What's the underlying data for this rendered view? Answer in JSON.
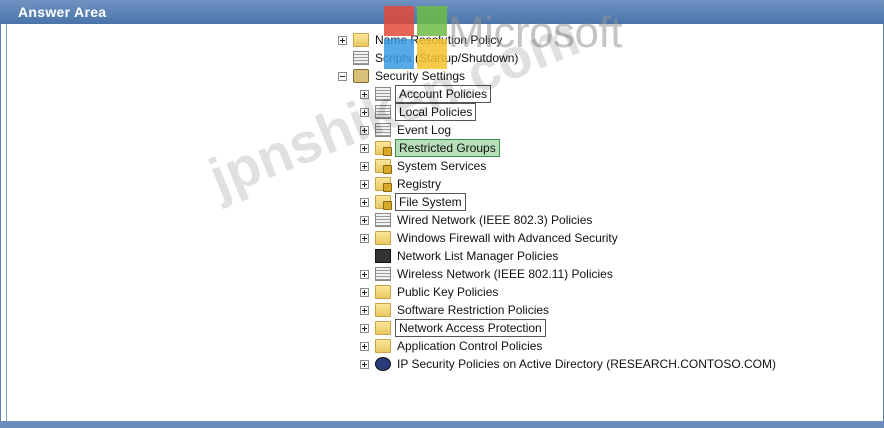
{
  "panel": {
    "title": "Answer Area"
  },
  "tree": {
    "items": [
      {
        "label": "Name Resolution Policy",
        "icon": "folder-icon",
        "expander": "plus"
      },
      {
        "label": "Scripts (Startup/Shutdown)",
        "icon": "script-icon",
        "expander": "none"
      },
      {
        "label": "Security Settings",
        "icon": "security-settings-icon",
        "expander": "minus"
      },
      {
        "label": "Account Policies",
        "icon": "policy-doc-icon",
        "expander": "plus",
        "boxed": true
      },
      {
        "label": "Local Policies",
        "icon": "policy-doc-icon",
        "expander": "plus",
        "boxed": true
      },
      {
        "label": "Event Log",
        "icon": "policy-doc-icon",
        "expander": "plus"
      },
      {
        "label": "Restricted Groups",
        "icon": "locked-folder-icon",
        "expander": "plus",
        "highlight": true
      },
      {
        "label": "System Services",
        "icon": "locked-folder-icon",
        "expander": "plus"
      },
      {
        "label": "Registry",
        "icon": "locked-folder-icon",
        "expander": "plus"
      },
      {
        "label": "File System",
        "icon": "locked-folder-icon",
        "expander": "plus",
        "boxed": true
      },
      {
        "label": "Wired Network (IEEE 802.3) Policies",
        "icon": "wired-network-icon",
        "expander": "plus"
      },
      {
        "label": "Windows Firewall with Advanced Security",
        "icon": "firewall-icon",
        "expander": "plus"
      },
      {
        "label": "Network List Manager Policies",
        "icon": "network-list-icon",
        "expander": "none"
      },
      {
        "label": "Wireless Network (IEEE 802.11) Policies",
        "icon": "wireless-network-icon",
        "expander": "plus"
      },
      {
        "label": "Public Key Policies",
        "icon": "folder-icon",
        "expander": "plus"
      },
      {
        "label": "Software Restriction Policies",
        "icon": "folder-icon",
        "expander": "plus"
      },
      {
        "label": "Network Access Protection",
        "icon": "folder-icon",
        "expander": "plus",
        "boxed": true
      },
      {
        "label": "Application Control Policies",
        "icon": "folder-icon",
        "expander": "plus"
      },
      {
        "label": "IP Security Policies on Active Directory (RESEARCH.CONTOSO.COM)",
        "icon": "ipsec-icon",
        "expander": "plus"
      }
    ]
  },
  "overlay": {
    "brand_text": "Microsoft",
    "watermark_text": "jpnshiken.com"
  },
  "colors": {
    "titlebar": "#4b74a9",
    "highlight": "#b7e0b9",
    "highlight_border": "#3a8b47"
  }
}
